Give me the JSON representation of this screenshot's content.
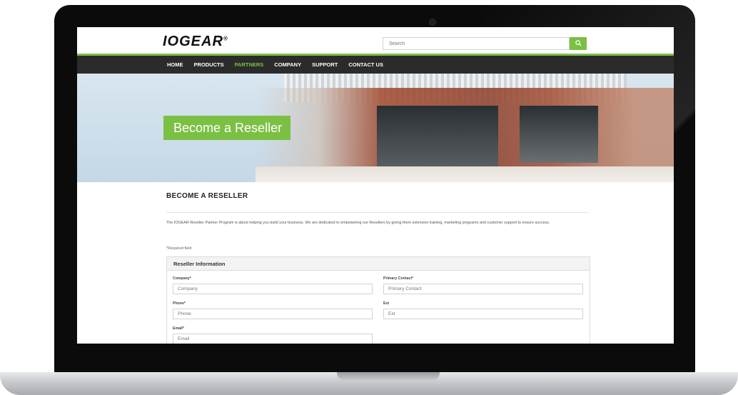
{
  "site": {
    "logo": "IOGEAR",
    "logo_mark": "®"
  },
  "search": {
    "placeholder": "Search",
    "button_icon": "search-icon"
  },
  "nav": {
    "items": [
      "HOME",
      "PRODUCTS",
      "PARTNERS",
      "COMPANY",
      "SUPPORT",
      "CONTACT US"
    ],
    "active": "PARTNERS"
  },
  "hero": {
    "button_label": "Become a Reseller"
  },
  "page": {
    "title": "BECOME A RESELLER",
    "intro": "The IOGEAR Reseller Partner Program is about helping you build your business. We are dedicated to empowering our Resellers by giving them extensive training, marketing programs and customer support to ensure success.",
    "required_note": "*Required field"
  },
  "form": {
    "panel_title": "Reseller Information",
    "fields": {
      "company": {
        "label": "Company*",
        "placeholder": "Company"
      },
      "primary_contact": {
        "label": "Primary Contact*",
        "placeholder": "Primary Contact"
      },
      "phone": {
        "label": "Phone*",
        "placeholder": "Phone"
      },
      "ext": {
        "label": "Ext",
        "placeholder": "Ext"
      },
      "email": {
        "label": "Email*",
        "placeholder": "Email"
      }
    }
  },
  "colors": {
    "accent": "#7bc043",
    "nav_bg": "#2b2b2c",
    "bezel": "#0b0b0c"
  }
}
